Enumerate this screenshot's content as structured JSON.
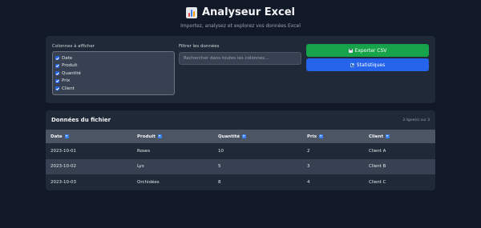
{
  "header": {
    "icon": "bar-chart-icon",
    "title": "Analyseur Excel",
    "subtitle": "Importez, analysez et explorez vos données Excel"
  },
  "columns_panel": {
    "label": "Colonnes à afficher",
    "items": [
      {
        "label": "Date",
        "checked": true
      },
      {
        "label": "Produit",
        "checked": true
      },
      {
        "label": "Quantité",
        "checked": true
      },
      {
        "label": "Prix",
        "checked": true
      },
      {
        "label": "Client",
        "checked": true
      }
    ]
  },
  "filter": {
    "label": "Filtrer les données",
    "placeholder": "Rechercher dans toutes les colonnes...",
    "value": ""
  },
  "actions": {
    "export_label": "Exporter CSV",
    "stats_label": "Statistiques"
  },
  "data_panel": {
    "title": "Données du fichier",
    "row_count": "3 ligne(s) sur 3",
    "headers": [
      "Date",
      "Produit",
      "Quantité",
      "Prix",
      "Client"
    ],
    "rows": [
      [
        "2023-10-01",
        "Roses",
        "10",
        "2",
        "Client A"
      ],
      [
        "2023-10-02",
        "Lys",
        "5",
        "3",
        "Client B"
      ],
      [
        "2023-10-03",
        "Orchidées",
        "8",
        "4",
        "Client C"
      ]
    ]
  },
  "colors": {
    "background": "#111827",
    "panel": "#1f2937",
    "export_button": "#16a34a",
    "stats_button": "#2563eb"
  }
}
